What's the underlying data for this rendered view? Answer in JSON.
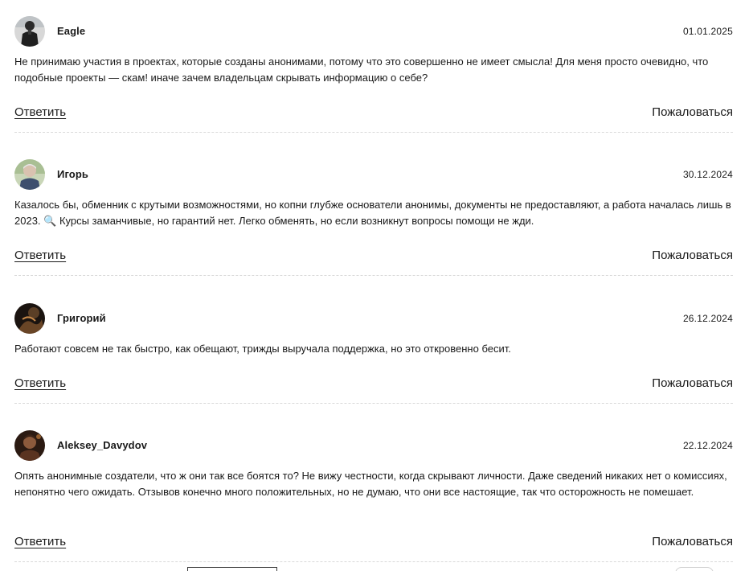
{
  "comments": [
    {
      "author": "Eagle",
      "date": "01.01.2025",
      "text": "Не принимаю участия в проектах, которые созданы анонимами, потому что это совершенно не имеет смысла! Для меня просто очевидно, что подобные проекты — скам! иначе зачем владельцам скрывать информацию о себе?",
      "reply_label": "Ответить",
      "report_label": "Пожаловаться"
    },
    {
      "author": "Игорь",
      "date": "30.12.2024",
      "text_before_emoji": "Казалось бы, обменник с крутыми возможностями, но копни глубже основатели анонимы, документы не предоставляют, а работа началась лишь в 2023. ",
      "emoji": "🔍",
      "text_after_emoji": " Курсы заманчивые, но гарантий нет. Легко обменять, но если возникнут вопросы помощи не жди.",
      "reply_label": "Ответить",
      "report_label": "Пожаловаться"
    },
    {
      "author": "Григорий",
      "date": "26.12.2024",
      "text": "Работают совсем не так быстро, как обещают, трижды выручала поддержка, но это откровенно бесит.",
      "reply_label": "Ответить",
      "report_label": "Пожаловаться"
    },
    {
      "author": "Aleksey_Davydov",
      "date": "22.12.2024",
      "text": "Опять анонимные создатели, что ж они так все боятся то? Не вижу честности, когда скрывают личности. Даже сведений никаких нет о комиссиях, непонятно чего ожидать. Отзывов конечно много положительных, но не думаю, что они все настоящие, так что осторожность не помешает.",
      "reply_label": "Ответить",
      "report_label": "Пожаловаться"
    }
  ]
}
